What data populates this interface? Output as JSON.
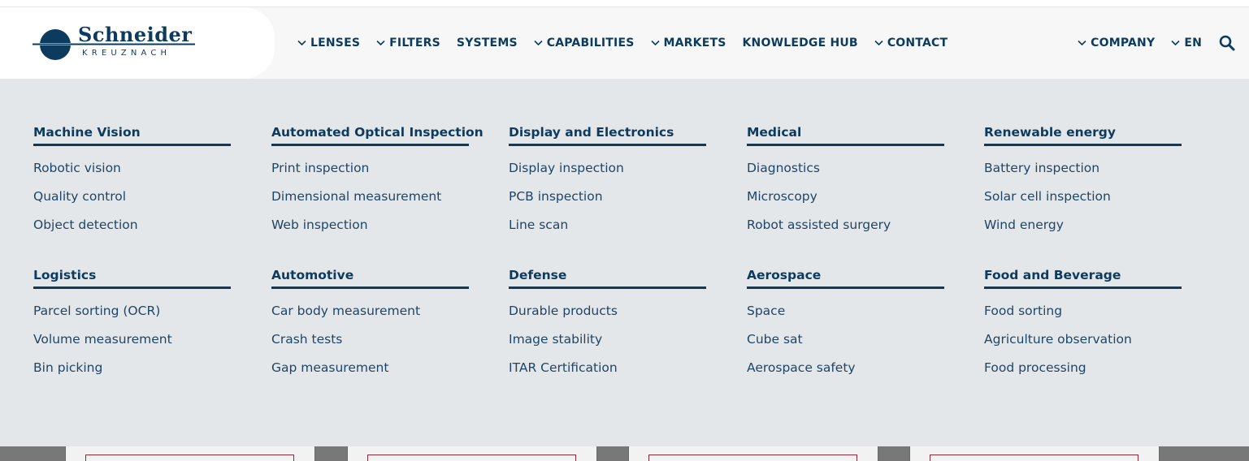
{
  "brand": {
    "name": "Schneider",
    "sub": "KREUZNACH",
    "primary_color": "#0d3b5e"
  },
  "nav": {
    "items": [
      {
        "label": "LENSES",
        "chevron": true
      },
      {
        "label": "FILTERS",
        "chevron": true
      },
      {
        "label": "SYSTEMS",
        "chevron": false
      },
      {
        "label": "CAPABILITIES",
        "chevron": true
      },
      {
        "label": "MARKETS",
        "chevron": true
      },
      {
        "label": "KNOWLEDGE HUB",
        "chevron": false
      },
      {
        "label": "CONTACT",
        "chevron": true
      }
    ],
    "right": [
      {
        "label": "COMPANY",
        "chevron": true
      },
      {
        "label": "EN",
        "chevron": true
      }
    ],
    "search_icon": "search-icon"
  },
  "markets": [
    {
      "title": "Machine Vision",
      "links": [
        "Robotic vision",
        "Quality control",
        "Object detection"
      ]
    },
    {
      "title": "Automated Optical Inspection",
      "links": [
        "Print inspection",
        "Dimensional measurement",
        "Web inspection"
      ]
    },
    {
      "title": "Display and Electronics",
      "links": [
        "Display inspection",
        "PCB inspection",
        "Line scan"
      ]
    },
    {
      "title": "Medical",
      "links": [
        "Diagnostics",
        "Microscopy",
        "Robot assisted surgery"
      ]
    },
    {
      "title": "Renewable energy",
      "links": [
        "Battery inspection",
        "Solar cell inspection",
        "Wind energy"
      ]
    },
    {
      "title": "Logistics",
      "links": [
        "Parcel sorting (OCR)",
        "Volume measurement",
        "Bin picking"
      ]
    },
    {
      "title": "Automotive",
      "links": [
        "Car body measurement",
        "Crash tests",
        "Gap measurement"
      ]
    },
    {
      "title": "Defense",
      "links": [
        "Durable products",
        "Image stability",
        "ITAR Certification"
      ]
    },
    {
      "title": "Aerospace",
      "links": [
        "Space",
        "Cube sat",
        "Aerospace safety"
      ]
    },
    {
      "title": "Food and Beverage",
      "links": [
        "Food sorting",
        "Agriculture observation",
        "Food processing"
      ]
    }
  ]
}
